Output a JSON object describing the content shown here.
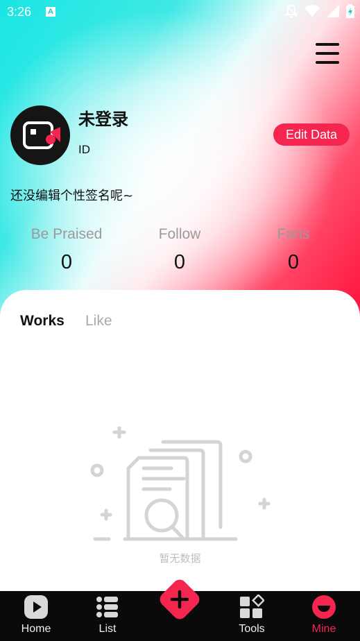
{
  "status_bar": {
    "time": "3:26",
    "app_badge": "A"
  },
  "profile": {
    "username": "未登录",
    "id_label": "ID",
    "edit_button": "Edit Data",
    "signature": "还没编辑个性签名呢~"
  },
  "stats": [
    {
      "label": "Be Praised",
      "value": "0"
    },
    {
      "label": "Follow",
      "value": "0"
    },
    {
      "label": "Fans",
      "value": "0"
    }
  ],
  "tabs": {
    "works": "Works",
    "like": "Like"
  },
  "empty_state": {
    "text": "暂无数据"
  },
  "bottom_nav": {
    "items": [
      {
        "label": "Home",
        "icon": "home-play-icon"
      },
      {
        "label": "List",
        "icon": "list-icon"
      },
      {
        "label": "Tools",
        "icon": "tools-icon"
      },
      {
        "label": "Mine",
        "icon": "mine-icon"
      }
    ],
    "active": "Mine",
    "fab_icon": "plus-icon"
  },
  "colors": {
    "accent": "#f4264f",
    "nav_bg": "#0a0a0a",
    "cyan": "#19e6e3"
  }
}
